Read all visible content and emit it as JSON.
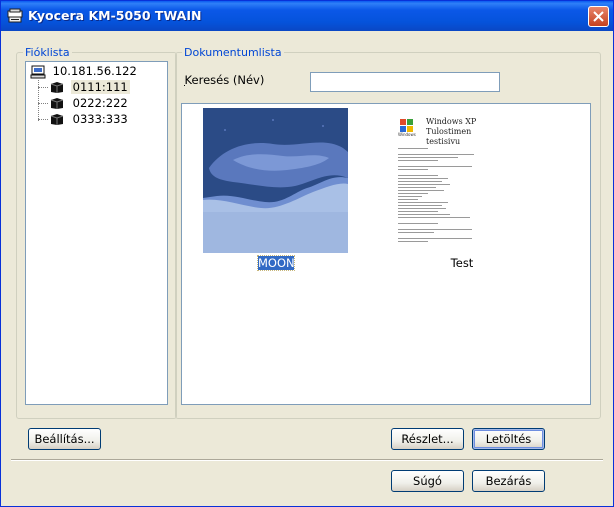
{
  "window": {
    "title": "Kyocera KM-5050 TWAIN"
  },
  "accounts": {
    "legend": "Fióklista",
    "root": {
      "label": "10.181.56.122",
      "icon": "computer-icon"
    },
    "items": [
      {
        "label": "0111:111",
        "icon": "box-icon",
        "selected": true
      },
      {
        "label": "0222:222",
        "icon": "box-icon",
        "selected": false
      },
      {
        "label": "0333:333",
        "icon": "box-icon",
        "selected": false
      }
    ]
  },
  "documents": {
    "legend": "Dokumentumlista",
    "search_label": "Keresés (Név)",
    "search_value": "",
    "items": [
      {
        "label": "MOON",
        "selected": true
      },
      {
        "label": "Test",
        "selected": false,
        "page_heading_line1": "Windows XP",
        "page_heading_line2": "Tulostimen",
        "page_heading_line3": "testisivu"
      }
    ]
  },
  "buttons": {
    "settings": "Beállítás...",
    "details": "Részlet...",
    "download": "Letöltés",
    "help": "Súgó",
    "close": "Bezárás"
  },
  "colors": {
    "title_bar": "#0553db",
    "legend": "#0046d5",
    "selection": "#316ac5"
  }
}
